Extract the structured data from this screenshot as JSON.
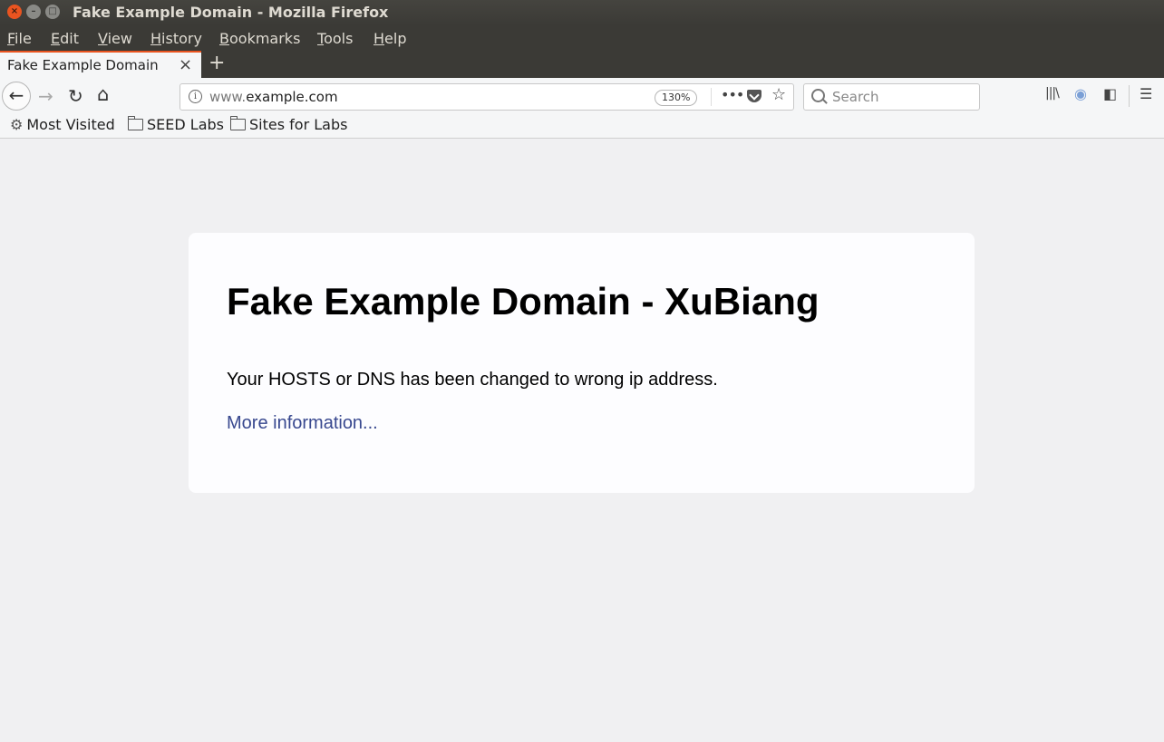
{
  "window": {
    "title": "Fake Example Domain - Mozilla Firefox",
    "close_glyph": "×",
    "min_glyph": "–",
    "max_glyph": "□"
  },
  "menu": [
    "File",
    "Edit",
    "View",
    "History",
    "Bookmarks",
    "Tools",
    "Help"
  ],
  "tabs": [
    {
      "title": "Fake Example Domain",
      "close_glyph": "×",
      "active": true
    }
  ],
  "new_tab_glyph": "+",
  "navigation": {
    "back_glyph": "←",
    "forward_glyph": "→",
    "reload_glyph": "↻",
    "home_glyph": "⌂"
  },
  "url_bar": {
    "info_glyph": "i",
    "url_prefix": "www.",
    "url_host": "example.com",
    "zoom": "130%",
    "page_actions_glyph": "•••",
    "bookmark_glyph": "☆"
  },
  "search_bar": {
    "placeholder": "Search"
  },
  "toolbar_icons": {
    "library": "|||\\",
    "extension": "◉",
    "sidebar": "◧",
    "menu": "☰"
  },
  "bookmarks": [
    {
      "label": "Most Visited",
      "icon": "gear-icon",
      "glyph": "⚙"
    },
    {
      "label": "SEED Labs",
      "icon": "folder-icon"
    },
    {
      "label": "Sites for Labs",
      "icon": "folder-icon"
    }
  ],
  "page": {
    "heading": "Fake Example Domain - XuBiang",
    "paragraph": "Your HOSTS or DNS has been changed to wrong ip address.",
    "link": "More information..."
  },
  "colors": {
    "accent": "#e95420",
    "link": "#38488f",
    "page_background": "#f0f0f2",
    "card_background": "#fdfdff"
  }
}
